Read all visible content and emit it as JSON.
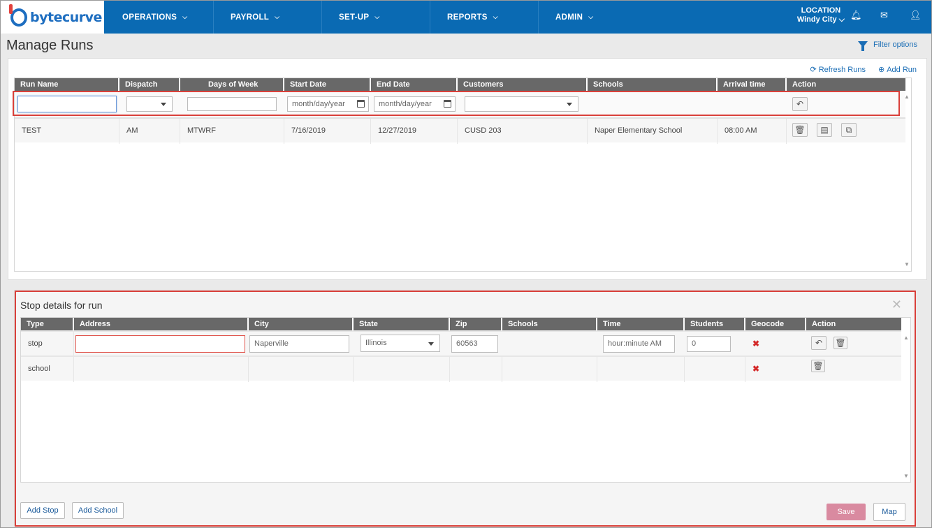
{
  "brand": {
    "name": "bytecurve"
  },
  "nav": [
    {
      "label": "OPERATIONS"
    },
    {
      "label": "PAYROLL"
    },
    {
      "label": "SET-UP"
    },
    {
      "label": "REPORTS"
    },
    {
      "label": "ADMIN"
    }
  ],
  "location": {
    "label": "LOCATION",
    "value": "Windy City"
  },
  "page": {
    "title": "Manage Runs",
    "filter_options": "Filter options"
  },
  "runs_toolbar": {
    "refresh": "Refresh Runs",
    "add": "Add Run"
  },
  "runs_table": {
    "columns": [
      "Run Name",
      "Dispatch",
      "Days of Week",
      "Start Date",
      "End Date",
      "Customers",
      "Schools",
      "Arrival time",
      "Action"
    ],
    "filters": {
      "start_placeholder": "month/day/year",
      "end_placeholder": "month/day/year"
    },
    "rows": [
      {
        "run_name": "TEST",
        "dispatch": "AM",
        "days": "MTWRF",
        "start": "7/16/2019",
        "end": "12/27/2019",
        "customers": "CUSD 203",
        "schools": "Naper Elementary School",
        "arrival": "08:00 AM"
      }
    ]
  },
  "stop_panel": {
    "title": "Stop details for run",
    "columns": [
      "Type",
      "Address",
      "City",
      "State",
      "Zip",
      "Schools",
      "Time",
      "Students",
      "Geocode",
      "Action"
    ],
    "rows": [
      {
        "type": "stop",
        "address": "",
        "city": "Naperville",
        "state": "Illinois",
        "zip": "60563",
        "time_placeholder": "hour:minute AM",
        "students": "0",
        "geocode": "✖"
      },
      {
        "type": "school",
        "geocode": "✖"
      }
    ],
    "buttons": {
      "add_stop": "Add Stop",
      "add_school": "Add School",
      "save": "Save",
      "map": "Map"
    }
  },
  "colors": {
    "nav_bg": "#0a6ab3",
    "header_bg": "#686868",
    "highlight": "#d9403a",
    "save_bg": "#d98aa0"
  }
}
